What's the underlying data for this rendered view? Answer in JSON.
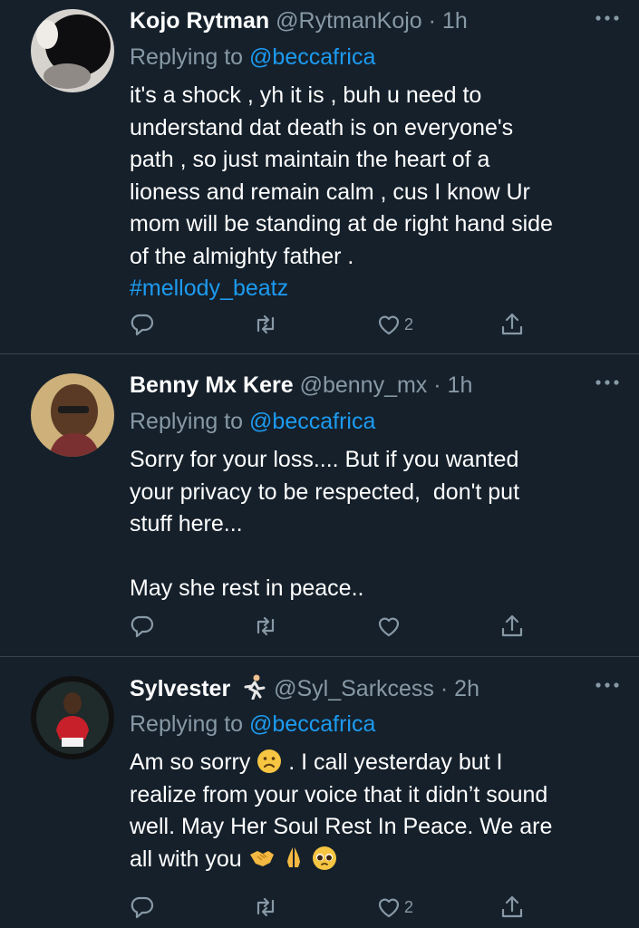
{
  "tweets": [
    {
      "name": "Kojo Rytman",
      "handle": "@RytmanKojo",
      "time": "· 1h",
      "replying_label": "Replying to",
      "replying_to": "@beccafrica",
      "text": "it's a shock , yh it is , buh u need to\nunderstand dat death is on everyone's\npath , so just maintain the heart of a\nlioness and remain calm , cus I know Ur\nmom will be standing at de right hand side\nof the almighty father .",
      "hashtag": "#mellody_beatz",
      "likes": "2"
    },
    {
      "name": "Benny Mx Kere",
      "handle": "@benny_mx",
      "time": "· 1h",
      "replying_label": "Replying to",
      "replying_to": "@beccafrica",
      "text": "Sorry for your loss.... But if you wanted\nyour privacy to be respected,  don't put\nstuff here...\n\nMay she rest in peace..",
      "likes": ""
    },
    {
      "name": "Sylvester",
      "handle": "@Syl_Sarkcess",
      "time": "· 2h",
      "replying_label": "Replying to",
      "replying_to": "@beccafrica",
      "text_part1": "Am so sorry",
      "text_part2": ". I call yesterday but I\nrealize from your voice that it didn’t sound\nwell. May Her Soul Rest In Peace. We are\nall with you",
      "likes": "2"
    }
  ],
  "colors": {
    "background": "#15202b",
    "muted": "#8899a6",
    "link": "#1d9bf0",
    "divider": "#38444d"
  },
  "icons": [
    "reply-icon",
    "retweet-icon",
    "like-icon",
    "share-icon",
    "more-icon"
  ]
}
